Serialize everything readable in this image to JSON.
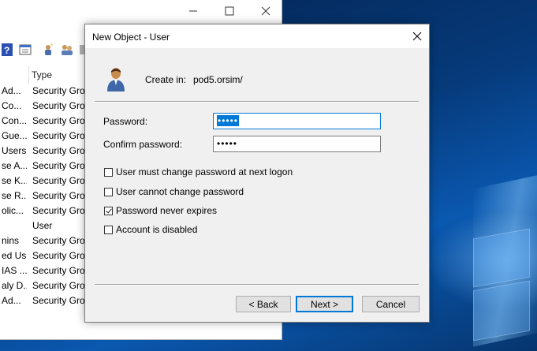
{
  "dialog": {
    "title": "New Object - User",
    "create_in_label": "Create in:",
    "create_in_value": "pod5.orsim/",
    "password_label": "Password:",
    "password_value": "•••••",
    "confirm_label": "Confirm password:",
    "confirm_value": "•••••",
    "options": [
      {
        "label": "User must change password at next logon",
        "checked": false
      },
      {
        "label": "User cannot change password",
        "checked": false
      },
      {
        "label": "Password never expires",
        "checked": true
      },
      {
        "label": "Account is disabled",
        "checked": false
      }
    ],
    "back_label": "< Back",
    "next_label": "Next >",
    "cancel_label": "Cancel"
  },
  "console": {
    "column_type": "Type",
    "rows": [
      {
        "name": "Ad...",
        "type": "Security Grou"
      },
      {
        "name": "Co...",
        "type": "Security Grou"
      },
      {
        "name": "Con...",
        "type": "Security Grou"
      },
      {
        "name": "Gue...",
        "type": "Security Grou"
      },
      {
        "name": "Users",
        "type": "Security Grou"
      },
      {
        "name": "se A...",
        "type": "Security Grou"
      },
      {
        "name": "se K...",
        "type": "Security Grou"
      },
      {
        "name": "se R...",
        "type": "Security Grou"
      },
      {
        "name": "olic...",
        "type": "Security Grou"
      },
      {
        "name": "",
        "type": "User"
      },
      {
        "name": "nins",
        "type": "Security Grou"
      },
      {
        "name": "ed Us...",
        "type": "Security Grou"
      },
      {
        "name": "IAS ...",
        "type": "Security Grou"
      },
      {
        "name": "aly D...",
        "type": "Security Grou"
      },
      {
        "name": "Ad...",
        "type": "Security Grou"
      }
    ]
  },
  "icons": {
    "window_minimize": "minimize-icon",
    "window_maximize": "maximize-icon",
    "window_close": "close-icon",
    "user": "user-icon"
  }
}
